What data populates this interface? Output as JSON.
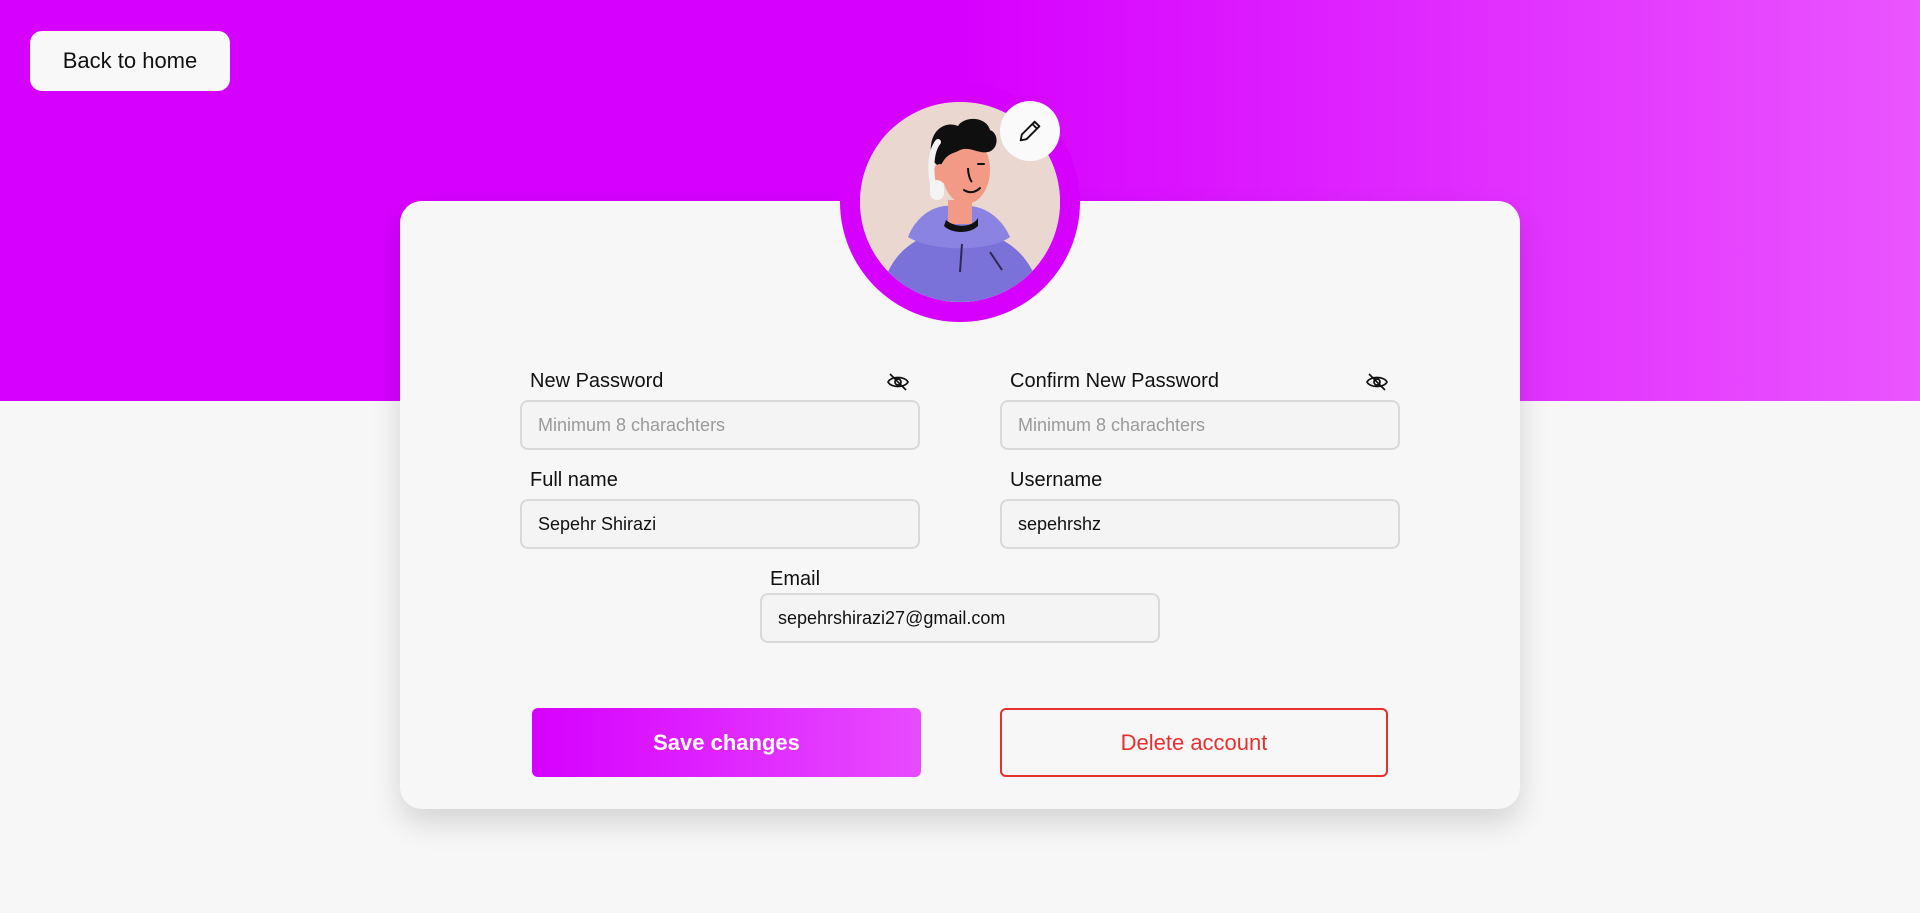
{
  "nav": {
    "back_label": "Back to home"
  },
  "profile": {
    "avatar_alt": "User avatar",
    "edit_icon": "pencil-icon"
  },
  "form": {
    "new_password": {
      "label": "New Password",
      "placeholder": "Minimum 8 charachters",
      "value": "",
      "toggle_icon": "eye-off-icon"
    },
    "confirm_password": {
      "label": "Confirm New Password",
      "placeholder": "Minimum 8 charachters",
      "value": "",
      "toggle_icon": "eye-off-icon"
    },
    "full_name": {
      "label": "Full name",
      "value": "Sepehr Shirazi"
    },
    "username": {
      "label": "Username",
      "value": "sepehrshz"
    },
    "email": {
      "label": "Email",
      "value": "sepehrshirazi27@gmail.com"
    }
  },
  "actions": {
    "save_label": "Save changes",
    "delete_label": "Delete account"
  },
  "colors": {
    "accent": "#d600ff",
    "accent_light": "#ea55ff",
    "danger": "#e53030",
    "background": "#f7f7f7"
  }
}
